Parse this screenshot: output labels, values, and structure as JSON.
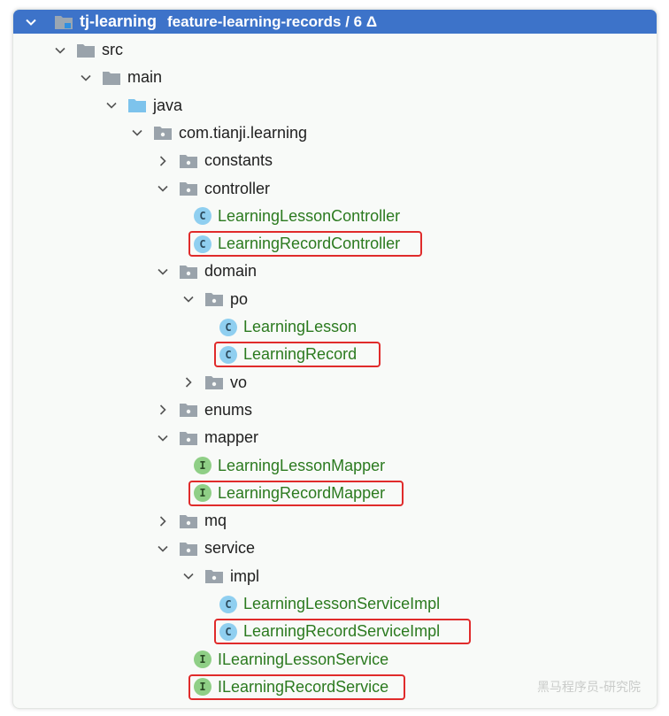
{
  "header": {
    "project": "tj-learning",
    "branch": "feature-learning-records / 6 Δ"
  },
  "tree": [
    {
      "label": "src",
      "indent": 1,
      "arrow": "open",
      "icon": "folder",
      "name": "node-src"
    },
    {
      "label": "main",
      "indent": 2,
      "arrow": "open",
      "icon": "folder",
      "name": "node-main"
    },
    {
      "label": "java",
      "indent": 3,
      "arrow": "open",
      "icon": "source-folder",
      "name": "node-java"
    },
    {
      "label": "com.tianji.learning",
      "indent": 4,
      "arrow": "open",
      "icon": "package",
      "name": "node-package"
    },
    {
      "label": "constants",
      "indent": 5,
      "arrow": "closed",
      "icon": "package",
      "name": "node-constants"
    },
    {
      "label": "controller",
      "indent": 5,
      "arrow": "open",
      "icon": "package",
      "name": "node-controller"
    },
    {
      "label": "LearningLessonController",
      "indent": 6,
      "arrow": "none",
      "icon": "class",
      "name": "node-learning-lesson-controller"
    },
    {
      "label": "LearningRecordController",
      "indent": 6,
      "arrow": "none",
      "icon": "class",
      "name": "node-learning-record-controller",
      "highlight": true
    },
    {
      "label": "domain",
      "indent": 5,
      "arrow": "open",
      "icon": "package",
      "name": "node-domain"
    },
    {
      "label": "po",
      "indent": 6,
      "arrow": "open",
      "icon": "package",
      "name": "node-po"
    },
    {
      "label": "LearningLesson",
      "indent": 7,
      "arrow": "none",
      "icon": "class",
      "name": "node-learning-lesson"
    },
    {
      "label": "LearningRecord",
      "indent": 7,
      "arrow": "none",
      "icon": "class",
      "name": "node-learning-record",
      "highlight": true
    },
    {
      "label": "vo",
      "indent": 6,
      "arrow": "closed",
      "icon": "package",
      "name": "node-vo"
    },
    {
      "label": "enums",
      "indent": 5,
      "arrow": "closed",
      "icon": "package",
      "name": "node-enums"
    },
    {
      "label": "mapper",
      "indent": 5,
      "arrow": "open",
      "icon": "package",
      "name": "node-mapper"
    },
    {
      "label": "LearningLessonMapper",
      "indent": 6,
      "arrow": "none",
      "icon": "interface",
      "name": "node-learning-lesson-mapper"
    },
    {
      "label": "LearningRecordMapper",
      "indent": 6,
      "arrow": "none",
      "icon": "interface",
      "name": "node-learning-record-mapper",
      "highlight": true
    },
    {
      "label": "mq",
      "indent": 5,
      "arrow": "closed",
      "icon": "package",
      "name": "node-mq"
    },
    {
      "label": "service",
      "indent": 5,
      "arrow": "open",
      "icon": "package",
      "name": "node-service"
    },
    {
      "label": "impl",
      "indent": 6,
      "arrow": "open",
      "icon": "package",
      "name": "node-impl"
    },
    {
      "label": "LearningLessonServiceImpl",
      "indent": 7,
      "arrow": "none",
      "icon": "class",
      "name": "node-learning-lesson-service-impl"
    },
    {
      "label": "LearningRecordServiceImpl",
      "indent": 7,
      "arrow": "none",
      "icon": "class",
      "name": "node-learning-record-service-impl",
      "highlight": true
    },
    {
      "label": "ILearningLessonService",
      "indent": 6,
      "arrow": "none",
      "icon": "interface",
      "name": "node-i-learning-lesson-service"
    },
    {
      "label": "ILearningRecordService",
      "indent": 6,
      "arrow": "none",
      "icon": "interface",
      "name": "node-i-learning-record-service",
      "highlight": true
    }
  ],
  "icon_letters": {
    "class": "C",
    "interface": "I"
  },
  "colors": {
    "header_bg": "#3d73c9",
    "class_text": "#2b7a1f",
    "highlight": "#e02b2b",
    "class_icon": "#8fcff0",
    "interface_icon": "#8fcf86"
  },
  "watermark": "黑马程序员-研究院"
}
